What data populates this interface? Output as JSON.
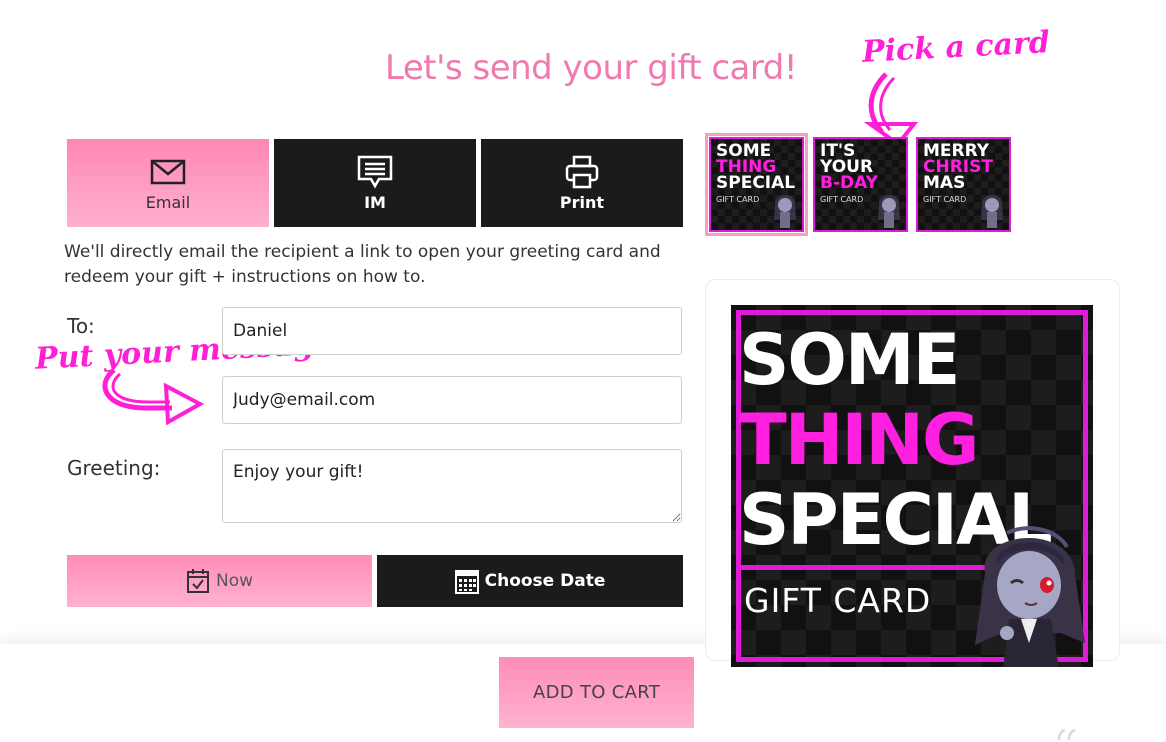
{
  "title": "Let's send your gift card!",
  "annotations": {
    "pick_card": "Pick a card",
    "put_message": "Put your message"
  },
  "tabs": [
    {
      "label": "Email",
      "icon": "envelope-icon",
      "active": true
    },
    {
      "label": "IM",
      "icon": "chat-icon",
      "active": false
    },
    {
      "label": "Print",
      "icon": "printer-icon",
      "active": false
    }
  ],
  "description": "We'll directly email the recipient a link to open your greeting card and redeem your gift + instructions on how to.",
  "form": {
    "to_label": "To:",
    "to_value": "Daniel",
    "email_value": "Judy@email.com",
    "greeting_label": "Greeting:",
    "greeting_value": "Enjoy your gift!"
  },
  "schedule": {
    "now_label": "Now",
    "choose_date_label": "Choose Date"
  },
  "cart": {
    "label": "ADD TO CART"
  },
  "cards": [
    {
      "lines": [
        "SOME",
        "THING",
        "SPECIAL"
      ],
      "magenta_line": 1,
      "subtitle": "GIFT CARD",
      "selected": true
    },
    {
      "lines": [
        "IT'S",
        "YOUR",
        "B-DAY"
      ],
      "magenta_line": 2,
      "subtitle": "GIFT CARD",
      "selected": false
    },
    {
      "lines": [
        "MERRY",
        "CHRIST",
        "MAS"
      ],
      "magenta_line": 1,
      "subtitle": "GIFT CARD",
      "selected": false
    }
  ],
  "preview": {
    "lines": [
      "SOME",
      "THING",
      "SPECIAL"
    ],
    "subtitle": "GIFT CARD"
  },
  "colors": {
    "pink": "#ff8cb8",
    "title_pink": "#f07ab0",
    "magenta": "#e01bd8",
    "dark": "#1b1b1b"
  }
}
